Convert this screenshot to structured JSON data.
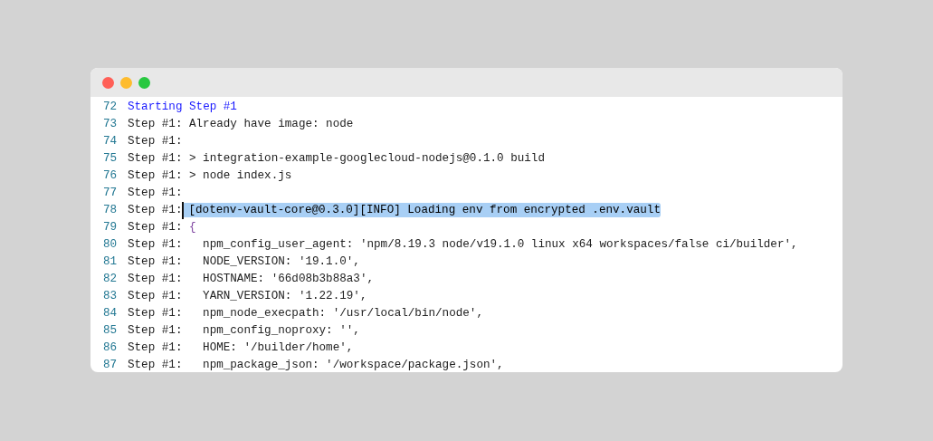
{
  "lines": [
    {
      "number": "72",
      "kind": "start",
      "text": "Starting Step #1",
      "selected": false
    },
    {
      "number": "73",
      "kind": "log",
      "prefix": "Step #1:",
      "text": "Already have image: node",
      "selected": false
    },
    {
      "number": "74",
      "kind": "log",
      "prefix": "Step #1:",
      "selected": false
    },
    {
      "number": "75",
      "kind": "log",
      "prefix": "Step #1:",
      "text": "> integration-example-googlecloud-nodejs@0.1.0 build",
      "selected": false
    },
    {
      "number": "76",
      "kind": "log",
      "prefix": "Step #1:",
      "text": "> node index.js",
      "selected": false
    },
    {
      "number": "77",
      "kind": "log",
      "prefix": "Step #1:",
      "selected": false
    },
    {
      "number": "78",
      "kind": "log",
      "prefix": "Step #1:",
      "text": "[dotenv-vault-core@0.3.0][INFO] Loading env from encrypted .env.vault",
      "selected": true
    },
    {
      "number": "79",
      "kind": "brace",
      "prefix": "Step #1:",
      "text": "{",
      "selected": false
    },
    {
      "number": "80",
      "kind": "log",
      "prefix": "Step #1:",
      "text": "  npm_config_user_agent: 'npm/8.19.3 node/v19.1.0 linux x64 workspaces/false ci/builder',",
      "selected": false
    },
    {
      "number": "81",
      "kind": "log",
      "prefix": "Step #1:",
      "text": "  NODE_VERSION: '19.1.0',",
      "selected": false
    },
    {
      "number": "82",
      "kind": "log",
      "prefix": "Step #1:",
      "text": "  HOSTNAME: '66d08b3b88a3',",
      "selected": false
    },
    {
      "number": "83",
      "kind": "log",
      "prefix": "Step #1:",
      "text": "  YARN_VERSION: '1.22.19',",
      "selected": false
    },
    {
      "number": "84",
      "kind": "log",
      "prefix": "Step #1:",
      "text": "  npm_node_execpath: '/usr/local/bin/node',",
      "selected": false
    },
    {
      "number": "85",
      "kind": "log",
      "prefix": "Step #1:",
      "text": "  npm_config_noproxy: '',",
      "selected": false
    },
    {
      "number": "86",
      "kind": "log",
      "prefix": "Step #1:",
      "text": "  HOME: '/builder/home',",
      "selected": false
    },
    {
      "number": "87",
      "kind": "log",
      "prefix": "Step #1:",
      "text": "  npm_package_json: '/workspace/package.json',",
      "selected": false
    }
  ]
}
